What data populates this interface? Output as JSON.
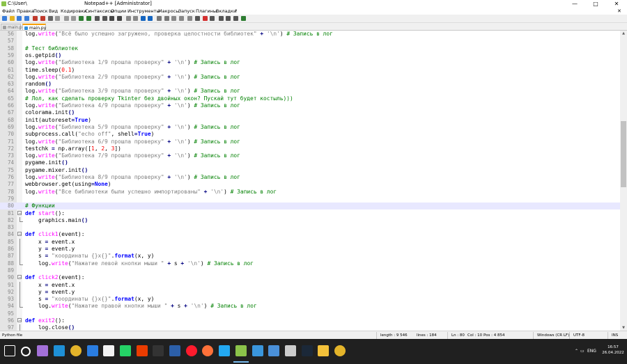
{
  "window": {
    "path": "C:\\User\\",
    "title": "Notepad++ [Administrator]",
    "minimize_glyph": "—",
    "maximize_glyph": "□",
    "close_glyph": "✕"
  },
  "menu": [
    "Файл",
    "Правка",
    "Поиск",
    "Вид",
    "Кодировки",
    "Синтаксисы",
    "Опции",
    "Инструменты",
    "Макросы",
    "Запуск",
    "Плагины",
    "Вкладки",
    "?"
  ],
  "menu_right": "✕",
  "toolbar_icons": [
    "new-file-icon",
    "open-file-icon",
    "save-icon",
    "save-all-icon",
    "close-icon",
    "close-all-icon",
    "print-icon",
    "cut-icon",
    "copy-icon",
    "paste-icon",
    "undo-icon",
    "redo-icon",
    "find-icon",
    "replace-icon",
    "zoom-in-icon",
    "zoom-out-icon",
    "sync-v-icon",
    "sync-h-icon",
    "word-wrap-icon",
    "show-all-chars-icon",
    "indent-guide-icon",
    "language-icon",
    "doc-map-icon",
    "function-list-icon",
    "folder-workspace-icon",
    "monitor-icon",
    "record-macro-icon",
    "stop-macro-icon",
    "play-macro-icon",
    "run-macro-icon",
    "save-macro-icon",
    "spellcheck-icon"
  ],
  "tabs": [
    {
      "label": "main.py",
      "active": false
    },
    {
      "label": "main.py",
      "active": true
    }
  ],
  "code_lines": [
    {
      "n": "56",
      "html": "log.<span class=\"fn\">write</span>(<span class=\"str\">\"Всё было успешно загружено, проверка целостности библиотек\"</span> <span class=\"op\">+</span> <span class=\"str\">'\\n'</span>) <span class=\"cm\"># Запись в лог</span>"
    },
    {
      "n": "57",
      "html": ""
    },
    {
      "n": "58",
      "html": "<span class=\"cm\"># Тест библиотек</span>"
    },
    {
      "n": "59",
      "html": "os.getpid<span class=\"op\">()</span>"
    },
    {
      "n": "60",
      "html": "log.<span class=\"fn\">write</span>(<span class=\"str\">\"Библиотека 1/9 прошла проверку\"</span> <span class=\"op\">+</span> <span class=\"str\">'\\n'</span>) <span class=\"cm\"># Запись в лог</span>"
    },
    {
      "n": "61",
      "html": "time.sleep(<span class=\"num\">0.1</span>)"
    },
    {
      "n": "62",
      "html": "log.<span class=\"fn\">write</span>(<span class=\"str\">\"Библиотека 2/9 прошла проверку\"</span> <span class=\"op\">+</span> <span class=\"str\">'\\n'</span>) <span class=\"cm\"># Запись в лог</span>"
    },
    {
      "n": "63",
      "html": "random<span class=\"op\">()</span>"
    },
    {
      "n": "64",
      "html": "log.<span class=\"fn\">write</span>(<span class=\"str\">\"Библиотека 3/9 прошла проверку\"</span> <span class=\"op\">+</span> <span class=\"str\">'\\n'</span>) <span class=\"cm\"># Запись в лог</span>"
    },
    {
      "n": "65",
      "html": "<span class=\"cm\"># Лол, как сделать проверку Tkinter без двойных окон? Пускай тут будет костыль)))</span>"
    },
    {
      "n": "66",
      "html": "log.<span class=\"fn\">write</span>(<span class=\"str\">\"Библиотека 4/9 прошла проверку\"</span> <span class=\"op\">+</span> <span class=\"str\">'\\n'</span>) <span class=\"cm\"># Запись в лог</span>"
    },
    {
      "n": "67",
      "html": "colorama.init<span class=\"op\">()</span>"
    },
    {
      "n": "68",
      "html": "init(autoreset<span class=\"op\">=</span><span class=\"kw\">True</span>)"
    },
    {
      "n": "69",
      "html": "log.<span class=\"fn\">write</span>(<span class=\"str\">\"Библиотека 5/9 прошла проверку\"</span> <span class=\"op\">+</span> <span class=\"str\">'\\n'</span>) <span class=\"cm\"># Запись в лог</span>"
    },
    {
      "n": "70",
      "html": "subprocess.call(<span class=\"str\">\"echo off\"</span>, shell<span class=\"op\">=</span><span class=\"kw\">True</span>)"
    },
    {
      "n": "71",
      "html": "log.<span class=\"fn\">write</span>(<span class=\"str\">\"Библиотека 6/9 прошла проверку\"</span> <span class=\"op\">+</span> <span class=\"str\">'\\n'</span>) <span class=\"cm\"># Запись в лог</span>"
    },
    {
      "n": "72",
      "html": "testchk <span class=\"op\">=</span> np.array([<span class=\"num\">1</span>, <span class=\"num\">2</span>, <span class=\"num\">3</span>])"
    },
    {
      "n": "73",
      "html": "log.<span class=\"fn\">write</span>(<span class=\"str\">\"Библиотека 7/9 прошла проверку\"</span> <span class=\"op\">+</span> <span class=\"str\">'\\n'</span>) <span class=\"cm\"># Запись в лог</span>"
    },
    {
      "n": "74",
      "html": "pygame.init<span class=\"op\">()</span>"
    },
    {
      "n": "75",
      "html": "pygame.mixer.init<span class=\"op\">()</span>"
    },
    {
      "n": "76",
      "html": "log.<span class=\"fn\">write</span>(<span class=\"str\">\"Библиотека 8/9 прошла проверку\"</span> <span class=\"op\">+</span> <span class=\"str\">'\\n'</span>) <span class=\"cm\"># Запись в лог</span>"
    },
    {
      "n": "77",
      "html": "webbrowser.get(using<span class=\"op\">=</span><span class=\"kw\">None</span>)"
    },
    {
      "n": "78",
      "html": "log.<span class=\"fn\">write</span>(<span class=\"str\">\"Все библиотеки были успешно импортированы\"</span> <span class=\"op\">+</span> <span class=\"str\">'\\n'</span>) <span class=\"cm\"># Запись в лог</span>"
    },
    {
      "n": "79",
      "html": ""
    },
    {
      "n": "80",
      "html": "<span class=\"cm\"># Функции</span>",
      "current": true
    },
    {
      "n": "81",
      "html": "<span class=\"kw\">def</span> <span class=\"fn\">start</span>():",
      "fold": "open"
    },
    {
      "n": "82",
      "html": "    graphics.main<span class=\"op\">()</span>",
      "fold": "end"
    },
    {
      "n": "83",
      "html": ""
    },
    {
      "n": "84",
      "html": "<span class=\"kw\">def</span> <span class=\"fn\">click1</span>(event):",
      "fold": "open"
    },
    {
      "n": "85",
      "html": "    x <span class=\"op\">=</span> event.x",
      "fold": "line"
    },
    {
      "n": "86",
      "html": "    y <span class=\"op\">=</span> event.y",
      "fold": "line"
    },
    {
      "n": "87",
      "html": "    s <span class=\"op\">=</span> <span class=\"str\">\"координаты {}x{}\"</span>.<span class=\"kw\">format</span>(x, y)",
      "fold": "line"
    },
    {
      "n": "88",
      "html": "    log.<span class=\"fn\">write</span>(<span class=\"str\">\"Нажатие левой кнопки мыши \"</span> <span class=\"op\">+</span> s <span class=\"op\">+</span> <span class=\"str\">'\\n'</span>) <span class=\"cm\"># Запись в лог</span>",
      "fold": "end"
    },
    {
      "n": "89",
      "html": ""
    },
    {
      "n": "90",
      "html": "<span class=\"kw\">def</span> <span class=\"fn\">click2</span>(event):",
      "fold": "open"
    },
    {
      "n": "91",
      "html": "    x <span class=\"op\">=</span> event.x",
      "fold": "line"
    },
    {
      "n": "92",
      "html": "    y <span class=\"op\">=</span> event.y",
      "fold": "line"
    },
    {
      "n": "93",
      "html": "    s <span class=\"op\">=</span> <span class=\"str\">\"координаты {}x{}\"</span>.<span class=\"kw\">format</span>(x, y)",
      "fold": "line"
    },
    {
      "n": "94",
      "html": "    log.<span class=\"fn\">write</span>(<span class=\"str\">\"Нажатие правой кнопки мыши \"</span> <span class=\"op\">+</span> s <span class=\"op\">+</span> <span class=\"str\">'\\n'</span>) <span class=\"cm\"># Запись в лог</span>",
      "fold": "end"
    },
    {
      "n": "95",
      "html": ""
    },
    {
      "n": "96",
      "html": "<span class=\"kw\">def</span> <span class=\"fn\">exit2</span>():",
      "fold": "open"
    },
    {
      "n": "97",
      "html": "    log.close<span class=\"op\">()</span>",
      "fold": "line"
    }
  ],
  "status": {
    "file_type": "Python file",
    "length": "length : 9 546",
    "lines": "lines : 184",
    "ln": "Ln : 80",
    "col": "Col : 10",
    "pos": "Pos : 4 854",
    "eol": "Windows (CR LF)",
    "encoding": "UTF-8",
    "mode": "INS"
  },
  "taskbar": {
    "apps": [
      "start-icon",
      "search-icon",
      "visual-studio-icon",
      "edge-icon",
      "chrome-icon",
      "mail-icon",
      "store-icon",
      "whatsapp-icon",
      "office-icon",
      "terminal-icon",
      "powershell-icon",
      "opera-icon",
      "browser-icon",
      "vscode-icon",
      "notepadpp-icon",
      "remote-desktop-icon",
      "file-manager-icon",
      "settings-icon",
      "steam-icon",
      "explorer-icon",
      "chrome-icon-2"
    ],
    "lang": "ENG",
    "time": "16:57",
    "date": "26.04.2022"
  },
  "colors": {
    "keyword": "#0000ff",
    "function": "#ff00ff",
    "string": "#808080",
    "number": "#ff0000",
    "comment": "#008000",
    "current_line": "#e8e8ff",
    "taskbar": "#202020"
  }
}
